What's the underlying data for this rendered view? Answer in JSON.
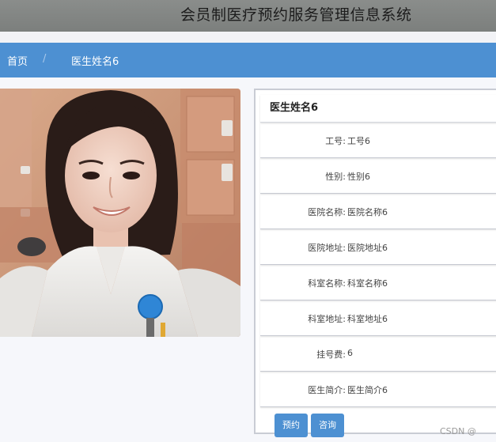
{
  "header": {
    "site_title": "会员制医疗预约服务管理信息系统"
  },
  "breadcrumb": {
    "home": "首页",
    "separator": "/",
    "current": "医生姓名6"
  },
  "doctor": {
    "title": "医生姓名6",
    "fields": [
      {
        "label": "工号:",
        "value": "工号6"
      },
      {
        "label": "性别:",
        "value": "性别6"
      },
      {
        "label": "医院名称:",
        "value": "医院名称6"
      },
      {
        "label": "医院地址:",
        "value": "医院地址6"
      },
      {
        "label": "科室名称:",
        "value": "科室名称6"
      },
      {
        "label": "科室地址:",
        "value": "科室地址6"
      },
      {
        "label": "挂号费:",
        "value": "6"
      },
      {
        "label": "医生简介:",
        "value": "医生简介6"
      }
    ]
  },
  "actions": {
    "book": "预约",
    "consult": "咨询"
  },
  "watermark": "CSDN @",
  "colors": {
    "header_bg": "#8a8d8b",
    "breadcrumb_bg": "#4d90d2",
    "button_bg": "#4d90d2"
  },
  "icons": {
    "photo": "doctor-photo"
  }
}
